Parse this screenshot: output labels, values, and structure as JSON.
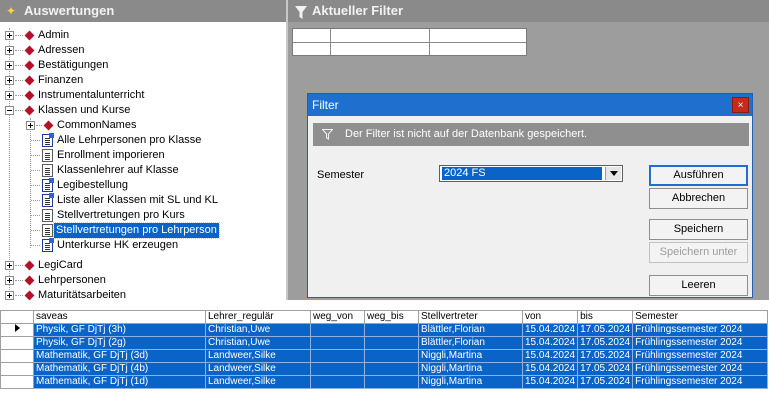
{
  "left_panel": {
    "title": "Auswertungen"
  },
  "filter_panel": {
    "title": "Aktueller Filter"
  },
  "tree": [
    {
      "label": "Admin"
    },
    {
      "label": "Adressen"
    },
    {
      "label": "Bestätigungen"
    },
    {
      "label": "Finanzen"
    },
    {
      "label": "Instrumentalunterricht"
    },
    {
      "label": "Klassen und Kurse"
    },
    {
      "label": "CommonNames"
    },
    {
      "label": "Alle Lehrpersonen pro Klasse"
    },
    {
      "label": "Enrollment imporieren"
    },
    {
      "label": "Klassenlehrer auf Klasse"
    },
    {
      "label": "Legibestellung"
    },
    {
      "label": "Liste aller Klassen mit SL und KL"
    },
    {
      "label": "Stellvertretungen pro Kurs"
    },
    {
      "label": "Stellvertretungen pro Lehrperson"
    },
    {
      "label": "Unterkurse HK erzeugen"
    },
    {
      "label": "LegiCard"
    },
    {
      "label": "Lehrpersonen"
    },
    {
      "label": "Maturitätsarbeiten"
    }
  ],
  "dialog": {
    "title": "Filter",
    "close_label": "×",
    "info": "Der Filter ist nicht auf der Datenbank gespeichert.",
    "semester_label": "Semester",
    "semester_value": "2024 FS",
    "buttons": {
      "execute": "Ausführen",
      "cancel": "Abbrechen",
      "save": "Speichern",
      "save_as": "Speichern unter",
      "clear": "Leeren"
    }
  },
  "grid": {
    "columns": [
      "saveas",
      "Lehrer_regulär",
      "weg_von",
      "weg_bis",
      "Stellvertreter",
      "von",
      "bis",
      "Semester"
    ],
    "rows": [
      [
        "Physik, GF DjTj (3h)",
        "Christian,Uwe",
        "",
        "",
        "Blättler,Florian",
        "15.04.2024",
        "17.05.2024",
        "Frühlingssemester 2024"
      ],
      [
        "Physik, GF DjTj (2g)",
        "Christian,Uwe",
        "",
        "",
        "Blättler,Florian",
        "15.04.2024",
        "17.05.2024",
        "Frühlingssemester 2024"
      ],
      [
        "Mathematik, GF DjTj (3d)",
        "Landweer,Silke",
        "",
        "",
        "Niggli,Martina",
        "15.04.2024",
        "17.05.2024",
        "Frühlingssemester 2024"
      ],
      [
        "Mathematik, GF DjTj (4b)",
        "Landweer,Silke",
        "",
        "",
        "Niggli,Martina",
        "15.04.2024",
        "17.05.2024",
        "Frühlingssemester 2024"
      ],
      [
        "Mathematik, GF DjTj (1d)",
        "Landweer,Silke",
        "",
        "",
        "Niggli,Martina",
        "15.04.2024",
        "17.05.2024",
        "Frühlingssemester 2024"
      ]
    ]
  },
  "colors": {
    "header_gray": "#8a8a8a",
    "selection_blue": "#0a64c8",
    "dialog_title_blue": "#1f6fcf",
    "close_red": "#c42b1c",
    "tree_diamond": "#b3122a"
  }
}
